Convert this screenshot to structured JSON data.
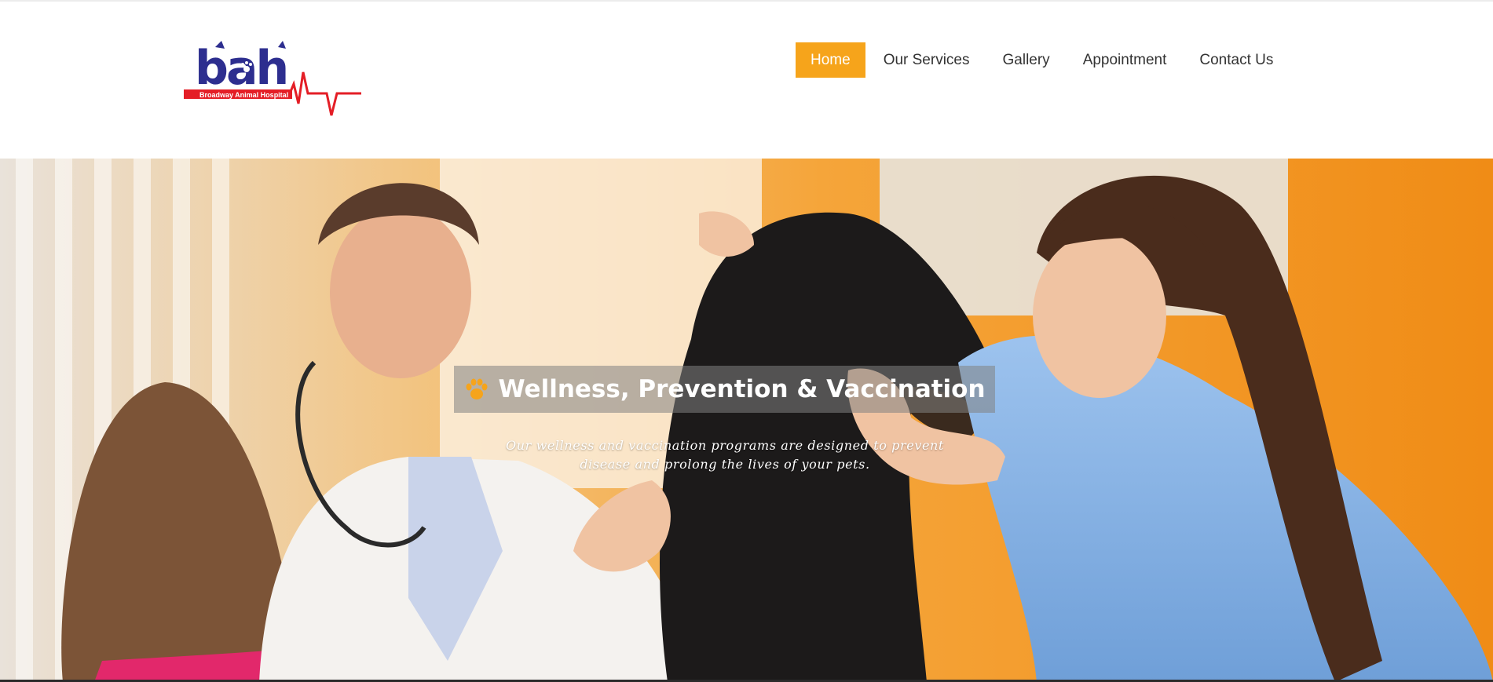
{
  "site": {
    "logo_text": "bah",
    "logo_subtitle": "Broadway Animal Hospital"
  },
  "nav": {
    "items": [
      {
        "label": "Home",
        "active": true
      },
      {
        "label": "Our Services",
        "active": false
      },
      {
        "label": "Gallery",
        "active": false
      },
      {
        "label": "Appointment",
        "active": false
      },
      {
        "label": "Contact Us",
        "active": false
      }
    ]
  },
  "hero": {
    "title": "Wellness, Prevention & Vaccination",
    "subtitle_line1": "Our wellness and vaccination programs are designed to prevent",
    "subtitle_line2": "disease and prolong the lives of your pets.",
    "title_icon": "paw-icon"
  },
  "colors": {
    "accent": "#f6a41b",
    "logo_blue": "#2d2e8f",
    "logo_red": "#e41e26",
    "hero_orange": "#f4a23a"
  }
}
